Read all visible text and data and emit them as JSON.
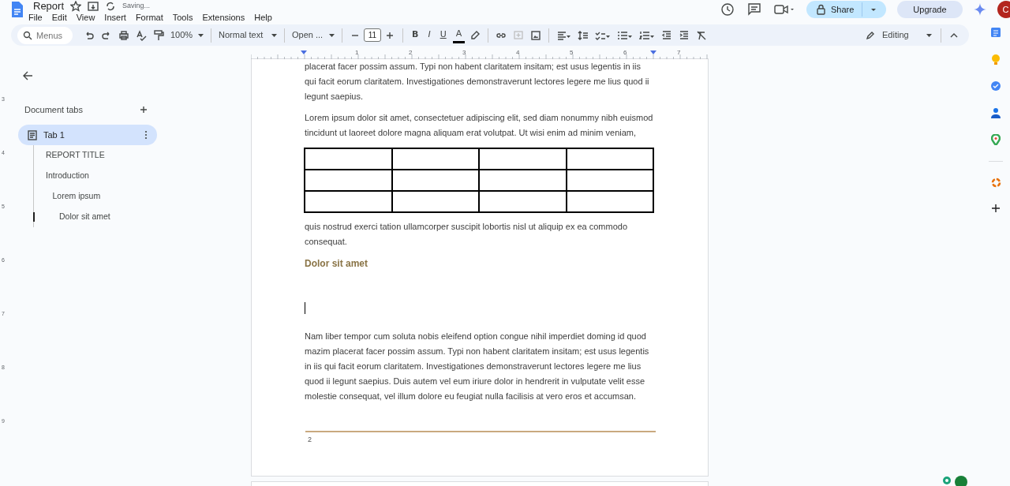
{
  "header": {
    "title": "Report",
    "save_status": "Saving...",
    "menu": [
      "File",
      "Edit",
      "View",
      "Insert",
      "Format",
      "Tools",
      "Extensions",
      "Help"
    ],
    "share": "Share",
    "upgrade": "Upgrade",
    "avatar": "C"
  },
  "toolbar": {
    "search_placeholder": "Menus",
    "zoom": "100%",
    "style": "Normal text",
    "font": "Open ...",
    "font_size": "11",
    "format_buttons": [
      "B",
      "I",
      "U",
      "A"
    ],
    "mode": "Editing"
  },
  "ruler": {
    "marks": [
      "1",
      "2",
      "3",
      "4",
      "5",
      "6",
      "7"
    ],
    "vertical_marks": [
      "3",
      "4",
      "5",
      "6",
      "7",
      "8",
      "9"
    ]
  },
  "outline": {
    "title": "Document tabs",
    "tabs": [
      {
        "label": "Tab 1",
        "selected": true,
        "children": [
          {
            "label": "REPORT TITLE",
            "selected": false
          },
          {
            "label": "Introduction",
            "selected": false,
            "children": [
              {
                "label": "Lorem ipsum",
                "selected": false,
                "children": [
                  {
                    "label": "Dolor sit amet",
                    "selected": true
                  }
                ]
              }
            ]
          }
        ]
      }
    ]
  },
  "document": {
    "blocks": [
      {
        "kind": "paragraph",
        "text": "placerat facer possim assum. Typi non habent claritatem insitam; est usus legentis in iis qui facit eorum claritatem. Investigationes demonstraverunt lectores legere me lius quod ii legunt saepius."
      },
      {
        "kind": "paragraph",
        "text": "Lorem ipsum dolor sit amet, consectetuer adipiscing elit, sed diam nonummy nibh euismod tincidunt ut laoreet dolore magna aliquam erat volutpat. Ut wisi enim ad minim veniam,"
      },
      {
        "kind": "table",
        "rows": [
          [
            {},
            {},
            {},
            {}
          ],
          [
            {},
            {},
            {},
            {}
          ],
          [
            {},
            {},
            {},
            {}
          ]
        ]
      },
      {
        "kind": "paragraph",
        "text": "quis nostrud exerci tation ullamcorper suscipit lobortis nisl ut aliquip ex ea commodo consequat."
      },
      {
        "kind": "heading",
        "text": "Dolor sit amet"
      },
      {
        "kind": "caret"
      },
      {
        "kind": "paragraph",
        "text": "Nam liber tempor cum soluta nobis eleifend option congue nihil imperdiet doming id quod mazim placerat facer possim assum. Typi non habent claritatem insitam; est usus legentis in iis qui facit eorum claritatem. Investigationes demonstraverunt lectores legere me lius quod ii legunt saepius. Duis autem vel eum iriure dolor in hendrerit in vulputate velit esse molestie consequat, vel illum dolore eu feugiat nulla facilisis at vero eros et accumsan."
      }
    ],
    "footer": {
      "page_number": "2"
    }
  }
}
